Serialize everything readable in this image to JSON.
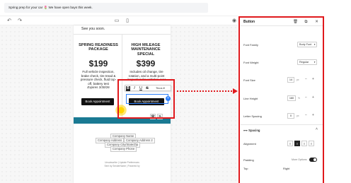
{
  "notice": {
    "text": "Spring prep for your car 🌷 We have open bays this week."
  },
  "toolbar": {
    "undo_icon": "undo-icon",
    "redo_icon": "redo-icon",
    "desktop_icon": "desktop-icon",
    "mobile_icon": "mobile-icon",
    "preview_icon": "eye-icon"
  },
  "email": {
    "intro": "See you soon.",
    "packages": [
      {
        "title": "SPRING READINESS PACKAGE",
        "price": "$199",
        "description": "Full vehicle inspection, brake check, tire tread & pressure check, fluid top-off, battery test",
        "expiry": "Expires 3/30/26",
        "button": "Book Appointment"
      },
      {
        "title": "HIGH MILEAGE MAINTENANCE SPECIAL",
        "price": "$399",
        "description": "Includes oil change, tire rotation, and a multi-point inspection for vehicles over",
        "button": "Book Appointment"
      }
    ],
    "footer": {
      "company_name": "Company Name",
      "address_1": "Company Address",
      "address_2": "Company Address 2",
      "city_state_zip": "Company City/State/Zip",
      "phone": "Company Phone",
      "unsubscribe": "Unsubscribe  |  Update Preferences",
      "sent_by": "Sent by SenderName  |  Powered by"
    }
  },
  "format_toolbar": {
    "bold": "B",
    "italic": "I",
    "underline": "U",
    "strike": "S",
    "font": "Tinos"
  },
  "panel": {
    "title": "Button",
    "font_family": {
      "label": "Font Family",
      "value": "Body Font"
    },
    "font_weight": {
      "label": "Font Weight",
      "value": "Regular"
    },
    "font_size": {
      "label": "Font Size",
      "value": "14",
      "unit": "px"
    },
    "line_height": {
      "label": "Line Height",
      "value": "160",
      "unit": "%"
    },
    "letter_spacing": {
      "label": "Letter Spacing",
      "value": "0",
      "unit": "px"
    },
    "spacing_section": "Spacing",
    "alignment": {
      "label": "Alignment",
      "options": [
        "≡",
        "≡",
        "≡",
        "≡"
      ],
      "active_index": 1
    },
    "padding": {
      "label": "Padding",
      "more": "More Options",
      "enabled": true
    },
    "top_label": "Top",
    "right_label": "Right"
  },
  "colors": {
    "accent": "#1a7a93",
    "annotation": "#e0191d",
    "selection": "#2d7ff9"
  }
}
